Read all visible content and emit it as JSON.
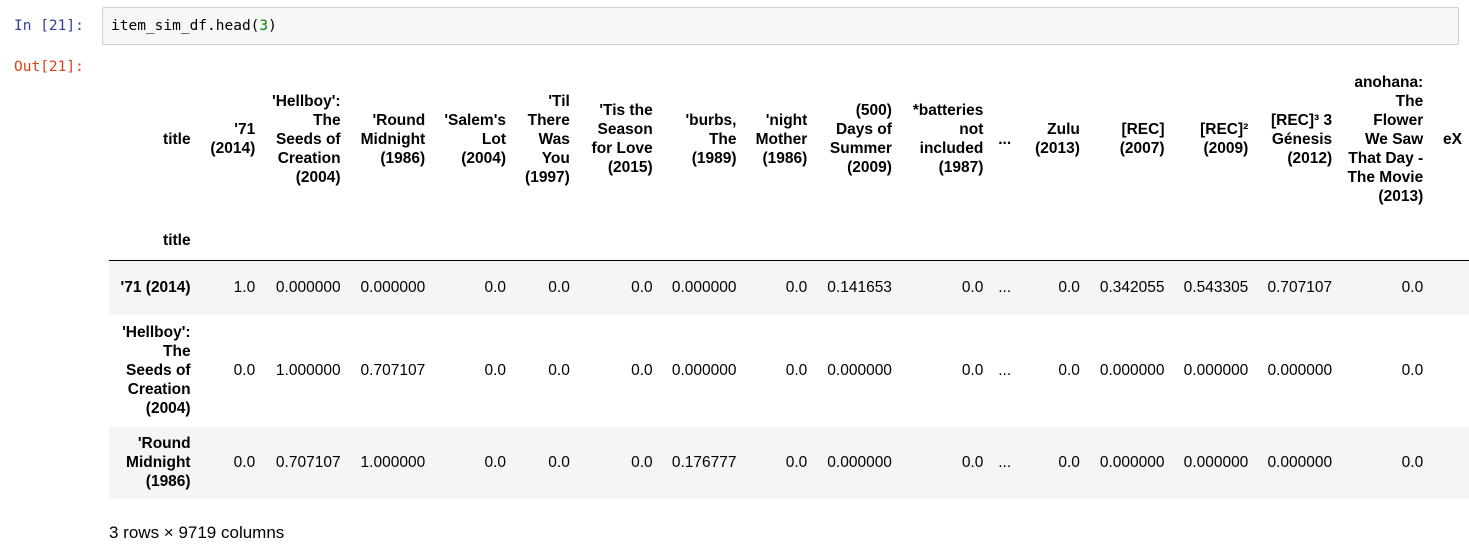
{
  "cell": {
    "in_prompt": "In [21]:",
    "out_prompt": "Out[21]:",
    "code_prefix": "item_sim_df.head(",
    "code_arg": "3",
    "code_suffix": ")"
  },
  "dataframe": {
    "columns_name": "title",
    "index_name": "title",
    "columns": [
      "'71 (2014)",
      "'Hellboy': The Seeds of Creation (2004)",
      "'Round Midnight (1986)",
      "'Salem's Lot (2004)",
      "'Til There Was You (1997)",
      "'Tis the Season for Love (2015)",
      "'burbs, The (1989)",
      "'night Mother (1986)",
      "(500) Days of Summer (2009)",
      "*batteries not included (1987)",
      "...",
      "Zulu (2013)",
      "[REC] (2007)",
      "[REC]² (2009)",
      "[REC]³ 3 Génesis (2012)",
      "anohana: The Flower We Saw That Day - The Movie (2013)",
      "eX"
    ],
    "rows": [
      {
        "index": "'71 (2014)",
        "values": [
          "1.0",
          "0.000000",
          "0.000000",
          "0.0",
          "0.0",
          "0.0",
          "0.000000",
          "0.0",
          "0.141653",
          "0.0",
          "...",
          "0.0",
          "0.342055",
          "0.543305",
          "0.707107",
          "0.0",
          ""
        ]
      },
      {
        "index": "'Hellboy': The Seeds of Creation (2004)",
        "values": [
          "0.0",
          "1.000000",
          "0.707107",
          "0.0",
          "0.0",
          "0.0",
          "0.000000",
          "0.0",
          "0.000000",
          "0.0",
          "...",
          "0.0",
          "0.000000",
          "0.000000",
          "0.000000",
          "0.0",
          ""
        ]
      },
      {
        "index": "'Round Midnight (1986)",
        "values": [
          "0.0",
          "0.707107",
          "1.000000",
          "0.0",
          "0.0",
          "0.0",
          "0.176777",
          "0.0",
          "0.000000",
          "0.0",
          "...",
          "0.0",
          "0.000000",
          "0.000000",
          "0.000000",
          "0.0",
          ""
        ]
      }
    ],
    "shape_text": "3 rows × 9719 columns"
  }
}
